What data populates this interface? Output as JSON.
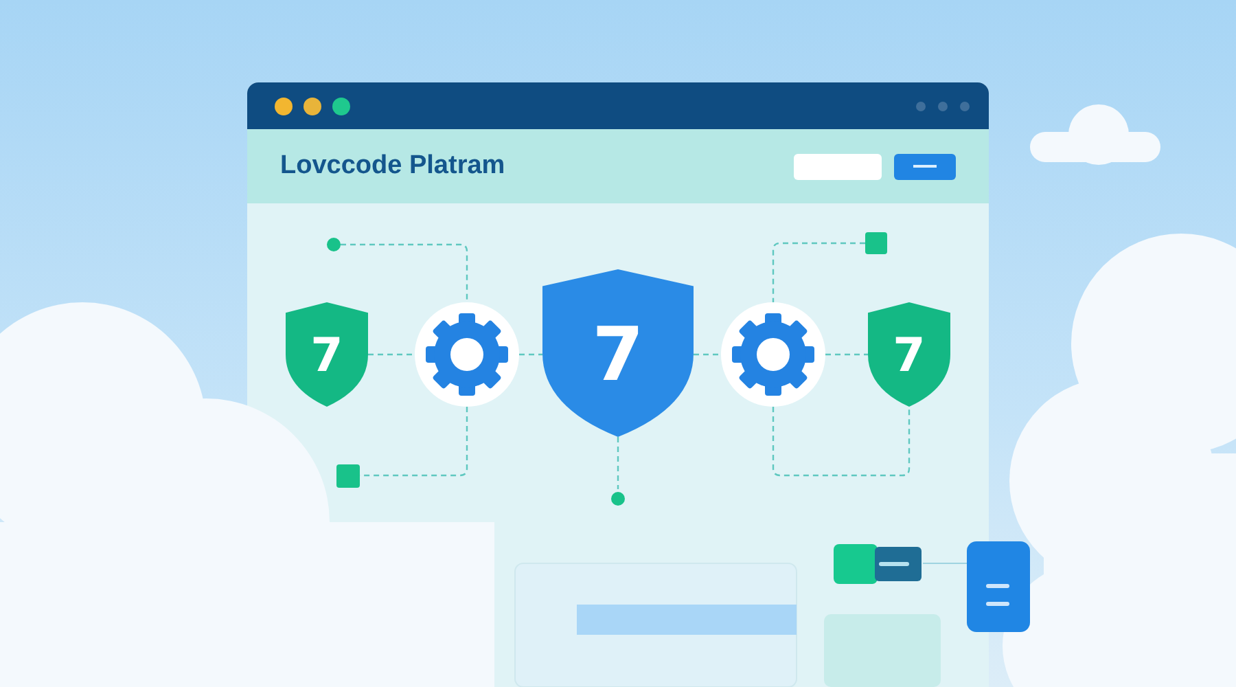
{
  "window": {
    "title": "Lovccode Platram",
    "controls": [
      {
        "color": "#f2b630"
      },
      {
        "color": "#e8b43a"
      },
      {
        "color": "#1fc98e"
      }
    ]
  },
  "diagram": {
    "shields": [
      {
        "label": "7",
        "color": "#14b884",
        "kind": "secondary"
      },
      {
        "label": "7",
        "color": "#2a8be6",
        "kind": "primary"
      },
      {
        "label": "7",
        "color": "#14b884",
        "kind": "secondary"
      }
    ]
  }
}
